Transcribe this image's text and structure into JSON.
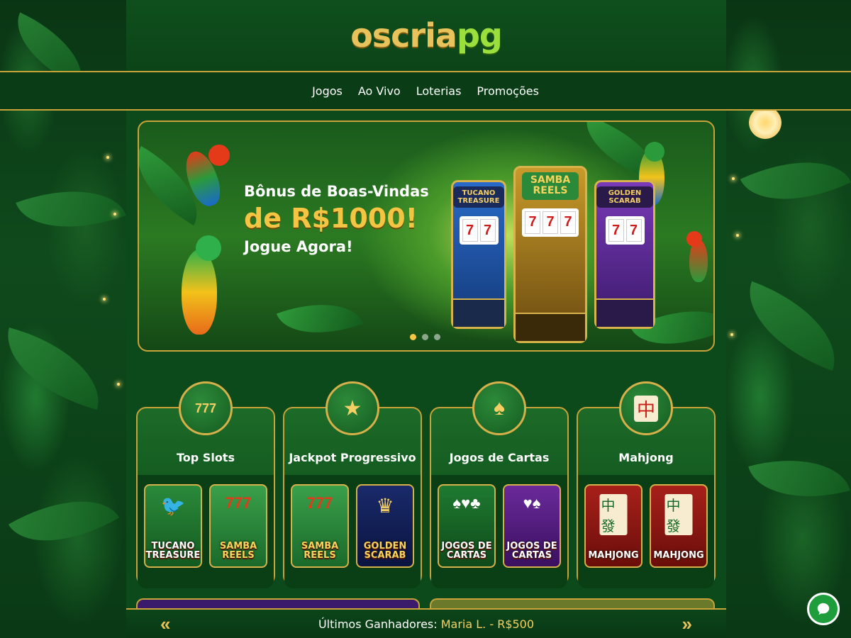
{
  "brand": {
    "logo_part1": "oscria",
    "logo_part2": "pg",
    "gold": "#e8c25a",
    "green": "#9adf3c"
  },
  "nav": {
    "items": [
      "Jogos",
      "Ao Vivo",
      "Loterias",
      "Promoções"
    ]
  },
  "hero": {
    "line1": "Bônus de Boas-Vindas",
    "line2": "de R$1000!",
    "line3": "Jogue Agora!",
    "slots": [
      {
        "sign": "TUCANO TREASURE",
        "reels": [
          "7",
          "7",
          "7"
        ]
      },
      {
        "sign": "SAMBA REELS",
        "reels": [
          "7",
          "7",
          "7"
        ]
      },
      {
        "sign": "GOLDEN SCARAB",
        "reels": [
          "7",
          "7",
          "7"
        ]
      }
    ],
    "carousel_active_index": 0,
    "carousel_count": 3
  },
  "categories": [
    {
      "title": "Top Slots",
      "icon": "slot-machine-icon",
      "glyph": "777",
      "games": [
        {
          "name": "TUCANO TREASURE",
          "icon": "toucan-icon",
          "glyph": "🐦"
        },
        {
          "name": "SAMBA REELS",
          "icon": "777-icon",
          "glyph": "777"
        }
      ]
    },
    {
      "title": "Jackpot Progressivo",
      "icon": "jackpot-star-icon",
      "glyph": "★",
      "games": [
        {
          "name": "SAMBA REELS",
          "icon": "777-icon",
          "glyph": "777"
        },
        {
          "name": "GOLDEN SCARAB",
          "icon": "pharaoh-icon",
          "glyph": "𓂀"
        }
      ]
    },
    {
      "title": "Jogos de Cartas",
      "icon": "playing-cards-icon",
      "glyph": "🂡",
      "games": [
        {
          "name": "JOGOS DE CARTAS",
          "icon": "cards-icon",
          "glyph": "♠♥♣"
        },
        {
          "name": "JOGOS DE CARTAS",
          "icon": "cards-icon",
          "glyph": "♥♠"
        }
      ]
    },
    {
      "title": "Mahjong",
      "icon": "mahjong-tile-icon",
      "glyph": "中",
      "games": [
        {
          "name": "MAHJONG",
          "icon": "mahjong-icon",
          "glyph": "中發"
        },
        {
          "name": "MAHJONG",
          "icon": "mahjong-icon",
          "glyph": "中發"
        }
      ]
    }
  ],
  "winners": {
    "label": "Últimos Ganhadores:",
    "entry": "Maria L. - R$500",
    "prev": "«",
    "next": "»"
  },
  "chat": {
    "icon": "chat-bubble-icon"
  }
}
